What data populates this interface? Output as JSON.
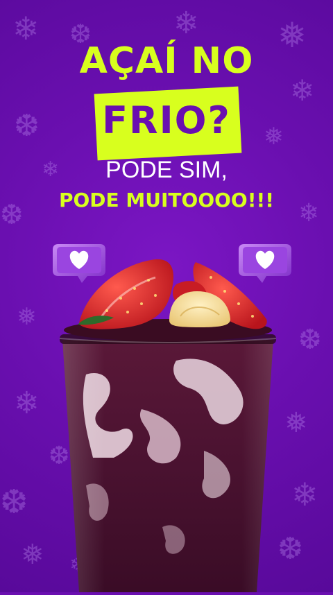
{
  "headline": {
    "line1": "AÇAÍ NO",
    "line2": "FRIO?",
    "line3": "PODE SIM,",
    "line4": "PODE MUITOOOO!!!"
  },
  "colors": {
    "background": "#6a0fb0",
    "accent": "#d8ff1e",
    "text_white": "#ffffff",
    "acai": "#4a1230",
    "strawberry": "#d8242a",
    "banana": "#f2d58a"
  },
  "icons": {
    "left_bubble": "heart-icon",
    "right_bubble": "heart-icon",
    "background_pattern": "snowflake-icon"
  }
}
